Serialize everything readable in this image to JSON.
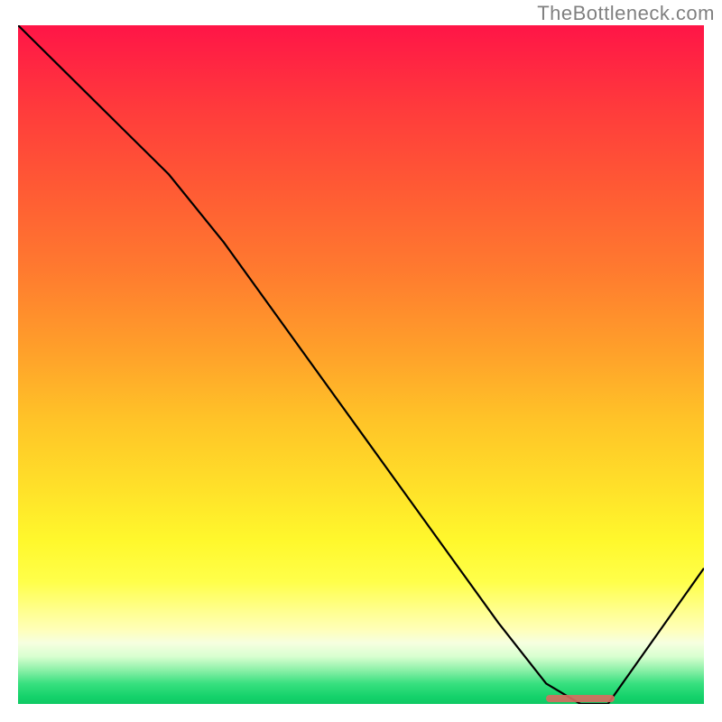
{
  "watermark": "TheBottleneck.com",
  "chart_data": {
    "type": "line",
    "title": "",
    "xlabel": "",
    "ylabel": "",
    "xlim": [
      0,
      100
    ],
    "ylim": [
      0,
      100
    ],
    "grid": false,
    "series": [
      {
        "name": "bottleneck-curve",
        "x": [
          0,
          10,
          22,
          30,
          40,
          50,
          60,
          70,
          77,
          82,
          86,
          100
        ],
        "values": [
          100,
          90,
          78,
          68,
          54,
          40,
          26,
          12,
          3,
          0,
          0,
          20
        ]
      }
    ],
    "minimum_region": {
      "x_start": 77,
      "x_end": 87,
      "y": 0.8
    },
    "gradient_stops_pct": {
      "top_color": "#ff1547",
      "mid_color": "#ffe029",
      "bottom_color": "#10c964"
    }
  }
}
